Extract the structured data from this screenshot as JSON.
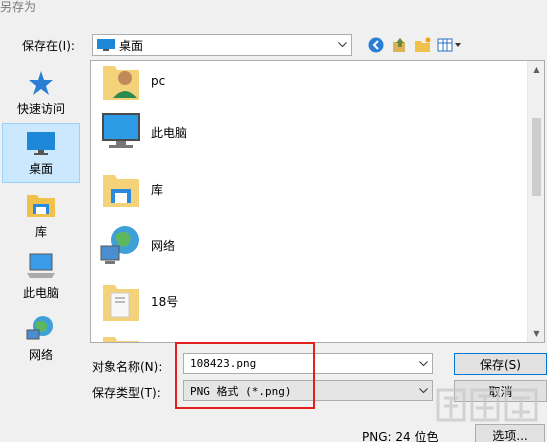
{
  "window": {
    "title": "另存为"
  },
  "save_in": {
    "label": "保存在(I):",
    "location": "桌面"
  },
  "places": [
    {
      "label": "快速访问",
      "icon": "star-icon"
    },
    {
      "label": "桌面",
      "icon": "desktop-icon",
      "selected": true
    },
    {
      "label": "库",
      "icon": "library-icon"
    },
    {
      "label": "此电脑",
      "icon": "computer-icon"
    },
    {
      "label": "网络",
      "icon": "network-icon"
    }
  ],
  "files": [
    {
      "name": "pc",
      "icon": "user-folder-icon"
    },
    {
      "name": "此电脑",
      "icon": "computer-icon"
    },
    {
      "name": "库",
      "icon": "library-icon"
    },
    {
      "name": "网络",
      "icon": "network-icon"
    },
    {
      "name": "18号",
      "icon": "folder-icon"
    }
  ],
  "filename": {
    "label": "对象名称(N):",
    "value": "108423.png"
  },
  "filetype": {
    "label": "保存类型(T):",
    "value": "PNG 格式 (*.png)"
  },
  "buttons": {
    "save": "保存(S)",
    "cancel": "取消",
    "options": "选项..."
  },
  "status": {
    "text": "PNG: 24 位色"
  },
  "colors": {
    "accent": "#0078d7",
    "highlight": "#e2201c",
    "selected": "#cce8ff"
  }
}
